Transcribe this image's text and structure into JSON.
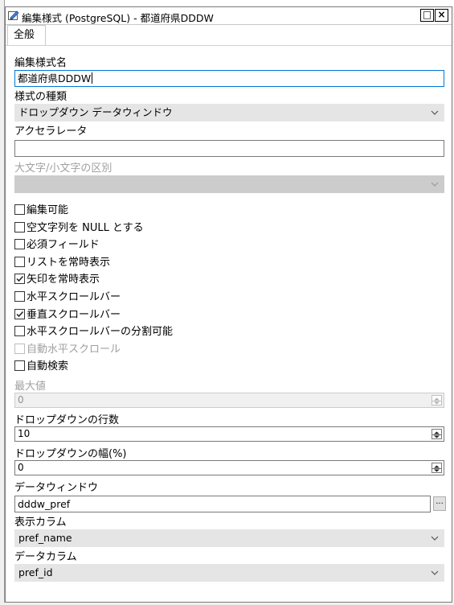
{
  "window": {
    "title": "編集様式 (PostgreSQL) - 都道府県DDDW",
    "restore_label": "□",
    "close_label": "×"
  },
  "tabs": [
    {
      "label": "全般"
    }
  ],
  "form": {
    "style_name_label": "編集様式名",
    "style_name_value": "都道府県DDDW",
    "style_type_label": "様式の種類",
    "style_type_value": "ドロップダウン データウィンドウ",
    "accelerator_label": "アクセラレータ",
    "accelerator_value": "",
    "case_label": "大文字/小文字の区別",
    "case_value": "",
    "checkboxes": [
      {
        "label": "編集可能",
        "checked": false,
        "enabled": true
      },
      {
        "label": "空文字列を NULL とする",
        "checked": false,
        "enabled": true
      },
      {
        "label": "必須フィールド",
        "checked": false,
        "enabled": true
      },
      {
        "label": "リストを常時表示",
        "checked": false,
        "enabled": true
      },
      {
        "label": "矢印を常時表示",
        "checked": true,
        "enabled": true
      },
      {
        "label": "水平スクロールバー",
        "checked": false,
        "enabled": true
      },
      {
        "label": "垂直スクロールバー",
        "checked": true,
        "enabled": true
      },
      {
        "label": "水平スクロールバーの分割可能",
        "checked": false,
        "enabled": true
      },
      {
        "label": "自動水平スクロール",
        "checked": false,
        "enabled": false
      },
      {
        "label": "自動検索",
        "checked": false,
        "enabled": true
      }
    ],
    "max_value_label": "最大値",
    "max_value": "0",
    "dropdown_rows_label": "ドロップダウンの行数",
    "dropdown_rows_value": "10",
    "dropdown_width_label": "ドロップダウンの幅(%)",
    "dropdown_width_value": "0",
    "datawindow_label": "データウィンドウ",
    "datawindow_value": "dddw_pref",
    "browse_label": "...",
    "display_column_label": "表示カラム",
    "display_column_value": "pref_name",
    "data_column_label": "データカラム",
    "data_column_value": "pref_id"
  },
  "colors": {
    "focus_border": "#0078d7",
    "combo_bg": "#e5e5e5",
    "disabled_text": "#a0a0a0"
  }
}
